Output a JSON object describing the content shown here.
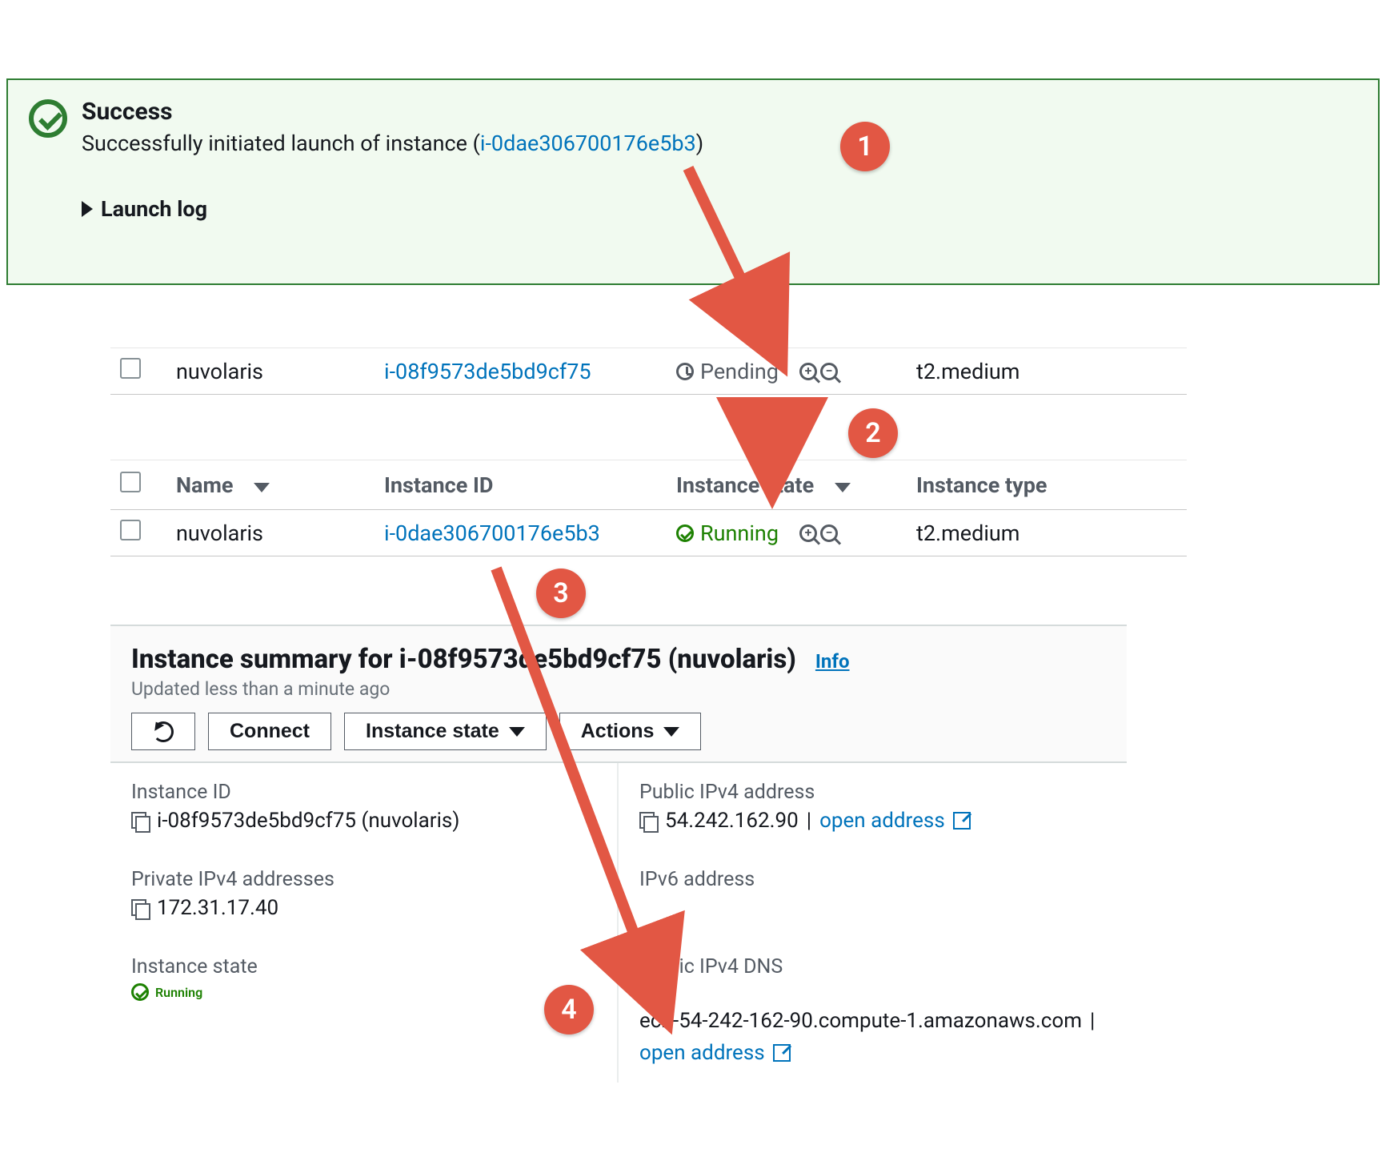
{
  "banner": {
    "title": "Success",
    "message_prefix": "Successfully initiated launch of instance (",
    "instance_link": "i-0dae306700176e5b3",
    "message_suffix": ")",
    "launch_log": "Launch log"
  },
  "annotations": {
    "c1": "1",
    "c2": "2",
    "c3": "3",
    "c4": "4"
  },
  "row_pending": {
    "name": "nuvolaris",
    "instance_id": "i-08f9573de5bd9cf75",
    "state": "Pending",
    "type": "t2.medium"
  },
  "table": {
    "headers": {
      "name": "Name",
      "instance_id": "Instance ID",
      "state": "Instance state",
      "type": "Instance type"
    },
    "row": {
      "name": "nuvolaris",
      "instance_id": "i-0dae306700176e5b3",
      "state": "Running",
      "type": "t2.medium"
    }
  },
  "summary": {
    "title": "Instance summary for i-08f9573de5bd9cf75 (nuvolaris)",
    "info": "Info",
    "subtitle": "Updated less than a minute ago",
    "buttons": {
      "connect": "Connect",
      "instance_state": "Instance state",
      "actions": "Actions"
    },
    "fields": {
      "instance_id_label": "Instance ID",
      "instance_id_value": "i-08f9573de5bd9cf75 (nuvolaris)",
      "public_ipv4_label": "Public IPv4 address",
      "public_ipv4_value": "54.242.162.90",
      "open_address": "open address",
      "private_ipv4_label": "Private IPv4 addresses",
      "private_ipv4_value": "172.31.17.40",
      "ipv6_label": "IPv6 address",
      "instance_state_label": "Instance state",
      "instance_state_value": "Running",
      "public_dns_label": "Public IPv4 DNS",
      "public_dns_value": "ec2-54-242-162-90.compute-1.amazonaws.com"
    }
  }
}
